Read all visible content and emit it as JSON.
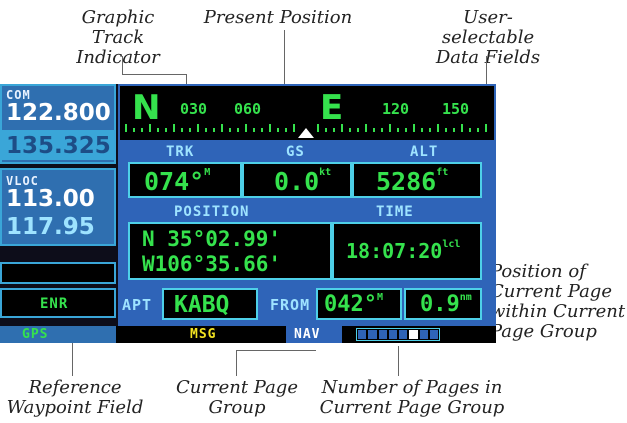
{
  "callouts": {
    "graphic_track": "Graphic Track Indicator",
    "present_position": "Present Position",
    "user_selectable": "User-selectable Data Fields",
    "position_in_group": "Position of Current Page within Current Page Group",
    "reference_waypoint": "Reference Waypoint Field",
    "current_group": "Current Page Group",
    "num_pages": "Number of Pages in Current Page Group"
  },
  "radio": {
    "com_label": "COM",
    "com_active": "122.800",
    "com_standby": "135.325",
    "vloc_label": "VLOC",
    "vloc_active": "113.00",
    "vloc_standby": "117.95",
    "mode": "ENR"
  },
  "compass": {
    "left_letter": "N",
    "t030": "030",
    "t060": "060",
    "right_letter": "E",
    "t120": "120",
    "t150": "150"
  },
  "fields": {
    "trk_label": "TRK",
    "gs_label": "GS",
    "alt_label": "ALT",
    "trk_value": "074°",
    "trk_unit": "M",
    "gs_value": "0.0",
    "gs_unit": "kt",
    "alt_value": "5286",
    "alt_unit": "ft",
    "position_label": "POSITION",
    "time_label": "TIME",
    "lat": "N 35°02.99'",
    "lon": "W106°35.66'",
    "time": "18:07:20",
    "time_unit": "lcl"
  },
  "waypoint": {
    "apt_label": "APT",
    "apt_value": "KABQ",
    "from_label": "FROM",
    "bearing": "042°",
    "bearing_unit": "M",
    "distance": "0.9",
    "distance_unit": "nm"
  },
  "status_bar": {
    "gps": "GPS",
    "msg": "MSG",
    "nav": "NAV"
  },
  "page_group": {
    "pages_total": 8,
    "current_page": 6
  },
  "colors": {
    "panel_blue": "#2f6fb0",
    "field_green": "#35e24d",
    "border_cyan": "#4ed0e8",
    "msg_yellow": "#f2e321"
  }
}
